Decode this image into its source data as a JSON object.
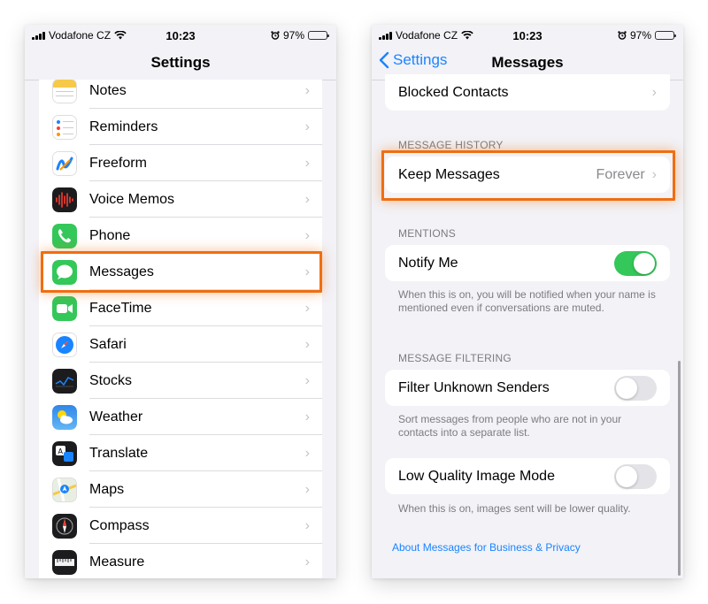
{
  "status_bar": {
    "carrier": "Vodafone CZ",
    "time": "10:23",
    "battery": "97%",
    "battery_level": 0.97
  },
  "left": {
    "title": "Settings",
    "items": [
      {
        "label": "Notes",
        "icon": "notes-icon"
      },
      {
        "label": "Reminders",
        "icon": "reminders-icon"
      },
      {
        "label": "Freeform",
        "icon": "freeform-icon"
      },
      {
        "label": "Voice Memos",
        "icon": "voice-memos-icon"
      },
      {
        "label": "Phone",
        "icon": "phone-icon"
      },
      {
        "label": "Messages",
        "icon": "messages-icon"
      },
      {
        "label": "FaceTime",
        "icon": "facetime-icon"
      },
      {
        "label": "Safari",
        "icon": "safari-icon"
      },
      {
        "label": "Stocks",
        "icon": "stocks-icon"
      },
      {
        "label": "Weather",
        "icon": "weather-icon"
      },
      {
        "label": "Translate",
        "icon": "translate-icon"
      },
      {
        "label": "Maps",
        "icon": "maps-icon"
      },
      {
        "label": "Compass",
        "icon": "compass-icon"
      },
      {
        "label": "Measure",
        "icon": "measure-icon"
      }
    ],
    "chevron": "›"
  },
  "right": {
    "back_label": "Settings",
    "title": "Messages",
    "blocked_contacts": "Blocked Contacts",
    "message_history_header": "MESSAGE HISTORY",
    "keep_messages": {
      "label": "Keep Messages",
      "value": "Forever"
    },
    "mentions_header": "MENTIONS",
    "notify_me": {
      "label": "Notify Me",
      "on": true
    },
    "notify_me_footnote": "When this is on, you will be notified when your name is mentioned even if conversations are muted.",
    "filtering_header": "MESSAGE FILTERING",
    "filter_unknown": {
      "label": "Filter Unknown Senders",
      "on": false
    },
    "filter_footnote": "Sort messages from people who are not in your contacts into a separate list.",
    "low_quality": {
      "label": "Low Quality Image Mode",
      "on": false
    },
    "low_quality_footnote": "When this is on, images sent will be lower quality.",
    "about_link": "About Messages for Business & Privacy",
    "chevron": "›"
  },
  "colors": {
    "highlight": "#f06e10",
    "toggle_on": "#34c759",
    "link": "#1a84ff"
  }
}
